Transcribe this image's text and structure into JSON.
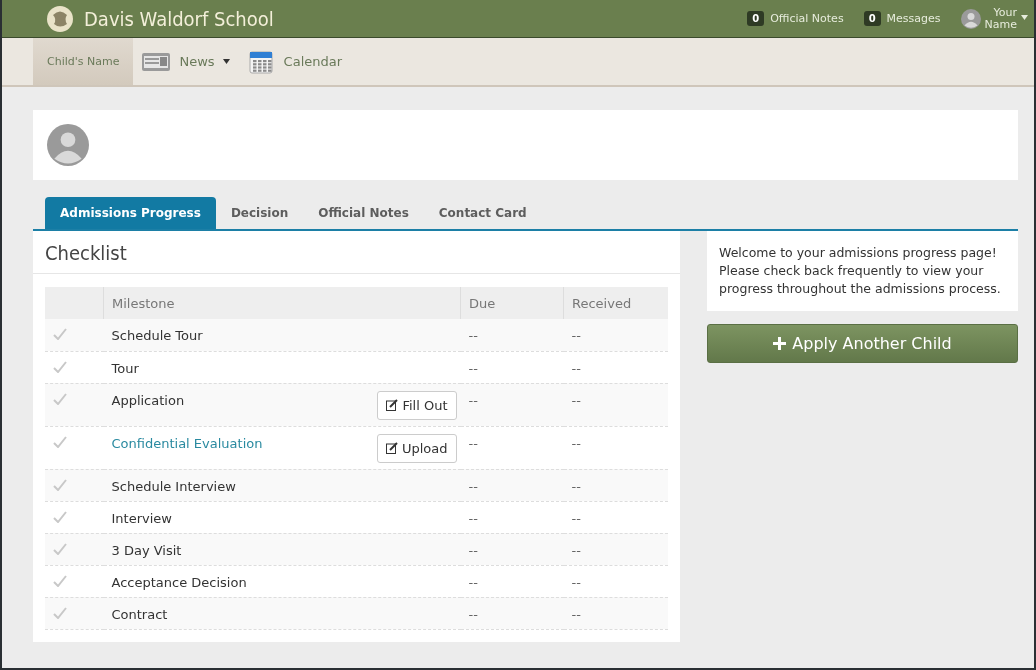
{
  "header": {
    "school": "Davis Waldorf School",
    "counters": [
      {
        "count": "0",
        "label": "Official Notes"
      },
      {
        "count": "0",
        "label": "Messages"
      }
    ],
    "user": [
      "Your",
      "Name"
    ]
  },
  "nav": [
    {
      "label": "Child's Name",
      "kind": "plain",
      "selected": true
    },
    {
      "label": "News",
      "kind": "news",
      "selected": false
    },
    {
      "label": "Calendar",
      "kind": "calendar",
      "selected": false
    }
  ],
  "tabs": [
    {
      "label": "Admissions Progress",
      "selected": true
    },
    {
      "label": "Decision",
      "selected": false
    },
    {
      "label": "Official Notes",
      "selected": false
    },
    {
      "label": "Contact Card",
      "selected": false
    }
  ],
  "checklist": {
    "title": "Checklist",
    "columns": [
      "Milestone",
      "Due",
      "Received"
    ],
    "rows": [
      {
        "milestone": "Schedule Tour",
        "kind": "text",
        "due": "--",
        "received": "--"
      },
      {
        "milestone": "Tour",
        "kind": "text",
        "due": "--",
        "received": "--"
      },
      {
        "milestone": "Application",
        "kind": "text",
        "action": "Fill Out",
        "due": "--",
        "received": "--"
      },
      {
        "milestone": "Confidential Evaluation",
        "kind": "link",
        "action": "Upload",
        "due": "--",
        "received": "--"
      },
      {
        "milestone": "Schedule Interview",
        "kind": "text",
        "due": "--",
        "received": "--"
      },
      {
        "milestone": "Interview",
        "kind": "text",
        "due": "--",
        "received": "--"
      },
      {
        "milestone": "3 Day Visit",
        "kind": "text",
        "due": "--",
        "received": "--"
      },
      {
        "milestone": "Acceptance Decision",
        "kind": "text",
        "due": "--",
        "received": "--"
      },
      {
        "milestone": "Contract",
        "kind": "text",
        "due": "--",
        "received": "--"
      }
    ]
  },
  "welcome": "Welcome to your admissions progress page! Please check back frequently to view your progress throughout the admissions process.",
  "apply_button": "Apply Another Child"
}
